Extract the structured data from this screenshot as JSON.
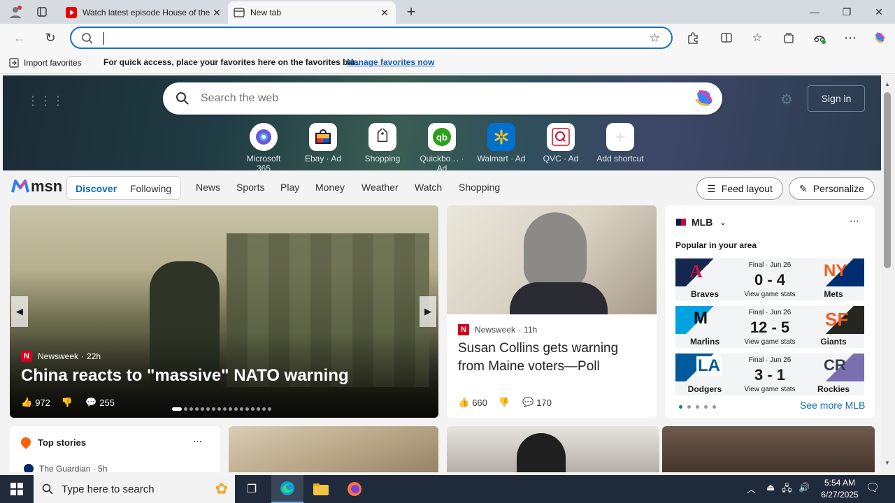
{
  "tabs": [
    {
      "title": "Watch latest episode House of the Dragon"
    },
    {
      "title": "New tab"
    }
  ],
  "favorites_bar": {
    "import_label": "Import favorites",
    "message": "For quick access, place your favorites here on the favorites bar.",
    "manage_link": "Manage favorites now"
  },
  "msn": {
    "search_placeholder": "Search the web",
    "sign_in": "Sign in",
    "shortcuts": [
      {
        "label": "Microsoft 365"
      },
      {
        "label": "Ebay · Ad"
      },
      {
        "label": "Shopping"
      },
      {
        "label": "Quickbo… · Ad"
      },
      {
        "label": "Walmart · Ad"
      },
      {
        "label": "QVC · Ad"
      },
      {
        "label": "Add shortcut"
      }
    ],
    "logo": "msn",
    "feed_tabs": [
      "Discover",
      "Following"
    ],
    "nav": [
      "News",
      "Sports",
      "Play",
      "Money",
      "Weather",
      "Watch",
      "Shopping"
    ],
    "feed_layout": "Feed layout",
    "personalize": "Personalize"
  },
  "hero_story": {
    "source": "Newsweek",
    "age": "22h",
    "headline": "China reacts to \"massive\" NATO warning",
    "likes": "972",
    "comments": "255"
  },
  "side_story": {
    "source": "Newsweek",
    "age": "11h",
    "headline": "Susan Collins gets warning from Maine voters—Poll",
    "likes": "660",
    "comments": "170"
  },
  "mlb": {
    "title": "MLB",
    "subtitle": "Popular in your area",
    "see_more": "See more MLB",
    "games": [
      {
        "status": "Final · Jun 26",
        "score": "0 - 4",
        "home": "Braves",
        "away": "Mets",
        "stats": "View game stats"
      },
      {
        "status": "Final · Jun 26",
        "score": "12 - 5",
        "home": "Marlins",
        "away": "Giants",
        "stats": "View game stats"
      },
      {
        "status": "Final · Jun 26",
        "score": "3 - 1",
        "home": "Dodgers",
        "away": "Rockies",
        "stats": "View game stats"
      }
    ]
  },
  "top_stories": {
    "title": "Top stories",
    "first_source": "The Guardian · 5h"
  },
  "taskbar": {
    "search_placeholder": "Type here to search",
    "time": "5:54 AM",
    "date": "6/27/2025"
  }
}
